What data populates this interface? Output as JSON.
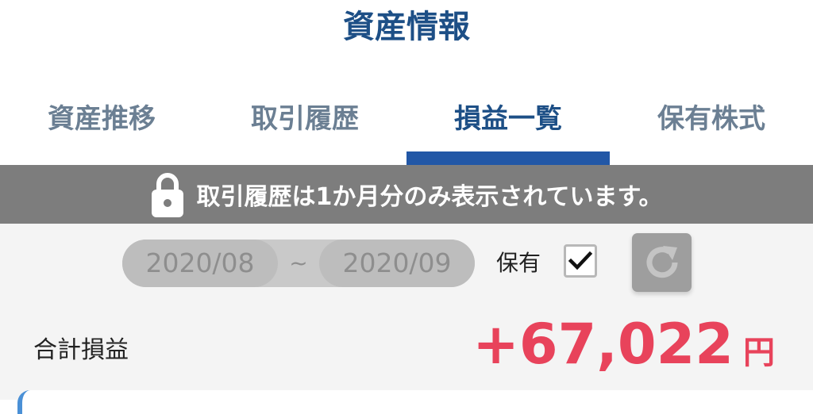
{
  "header": {
    "title": "資産情報"
  },
  "tabs": [
    {
      "label": "資産推移",
      "active": false
    },
    {
      "label": "取引履歴",
      "active": false
    },
    {
      "label": "損益一覧",
      "active": true
    },
    {
      "label": "保有株式",
      "active": false
    }
  ],
  "notice": {
    "text": "取引履歴は1か月分のみ表示されています。",
    "icon": "lock-icon"
  },
  "filter": {
    "date_from": "2020/08",
    "separator": "~",
    "date_to": "2020/09",
    "hold_label": "保有",
    "hold_checked": true,
    "refresh_icon": "refresh-icon"
  },
  "summary": {
    "total_label": "合計損益",
    "total_value": "+67,022",
    "unit": "円"
  },
  "colors": {
    "title": "#1d4f86",
    "tab_active_indicator": "#2257a6",
    "notice_bg": "#7d7d7d",
    "profit": "#e8435b"
  }
}
